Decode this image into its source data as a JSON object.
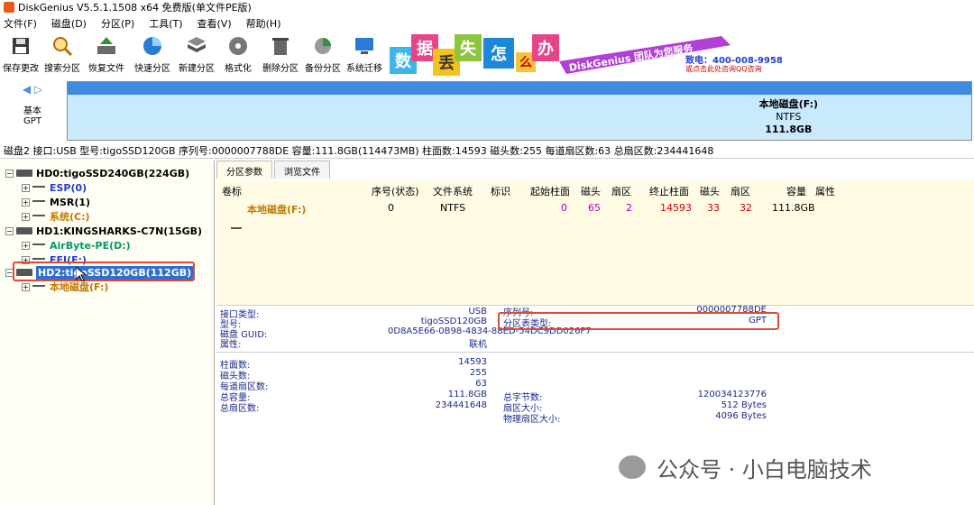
{
  "window": {
    "title": "DiskGenius V5.5.1.1508 x64 免费版(单文件PE版)"
  },
  "menu": [
    "文件(F)",
    "磁盘(D)",
    "分区(P)",
    "工具(T)",
    "查看(V)",
    "帮助(H)"
  ],
  "toolbar": [
    {
      "label": "保存更改",
      "icon": "save-icon"
    },
    {
      "label": "搜索分区",
      "icon": "search-icon"
    },
    {
      "label": "恢复文件",
      "icon": "recover-icon"
    },
    {
      "label": "快速分区",
      "icon": "quick-partition-icon"
    },
    {
      "label": "新建分区",
      "icon": "new-partition-icon"
    },
    {
      "label": "格式化",
      "icon": "format-icon"
    },
    {
      "label": "删除分区",
      "icon": "delete-icon"
    },
    {
      "label": "备份分区",
      "icon": "backup-icon"
    },
    {
      "label": "系统迁移",
      "icon": "migrate-icon"
    }
  ],
  "banner": {
    "tiles": [
      "数",
      "据",
      "丢",
      "失",
      "怎",
      "么",
      "办"
    ],
    "tagline": "DiskGenius 团队为您服务",
    "phone": "400-008-9958",
    "phone_label": "致电：",
    "qq": "或点击此处咨询QQ咨询"
  },
  "disk_nav": {
    "line1": "基本",
    "line2": "GPT"
  },
  "disk_vis": {
    "name": "本地磁盘(F:)",
    "fs": "NTFS",
    "size": "111.8GB"
  },
  "disk_info": "磁盘2 接口:USB  型号:tigoSSD120GB  序列号:0000007788DE  容量:111.8GB(114473MB)  柱面数:14593  磁头数:255  每道扇区数:63  总扇区数:234441648",
  "tree": [
    {
      "label": "HD0:tigoSSD240GB(224GB)",
      "type": "disk",
      "color": "#000000"
    },
    {
      "label": "ESP(0)",
      "type": "part",
      "color": "#1f3fcf"
    },
    {
      "label": "MSR(1)",
      "type": "part",
      "color": "#000000"
    },
    {
      "label": "系统(C:)",
      "type": "part",
      "color": "#c07a00"
    },
    {
      "label": "HD1:KINGSHARKS-C7N(15GB)",
      "type": "disk",
      "color": "#000000"
    },
    {
      "label": "AirByte-PE(D:)",
      "type": "part",
      "color": "#009a6a"
    },
    {
      "label": "EFI(E:)",
      "type": "part",
      "color": "#1f3fcf"
    },
    {
      "label": "HD2:tigoSSD120GB(112GB)",
      "type": "disk",
      "color": "#ffffff"
    },
    {
      "label": "本地磁盘(F:)",
      "type": "part",
      "color": "#c07a00"
    }
  ],
  "tabs": [
    "分区参数",
    "浏览文件"
  ],
  "columns": [
    "卷标",
    "序号(状态)",
    "文件系统",
    "标识",
    "起始柱面",
    "磁头",
    "扇区",
    "终止柱面",
    "磁头",
    "扇区",
    "容量",
    "属性"
  ],
  "row": [
    "本地磁盘(F:)",
    "0",
    "NTFS",
    "",
    "0",
    "65",
    "2",
    "14593",
    "33",
    "32",
    "111.8GB",
    ""
  ],
  "details": {
    "iface_k": "接口类型:",
    "iface_v": "USB",
    "model_k": "型号:",
    "model_v": "tigoSSD120GB",
    "guid_k": "磁盘 GUID:",
    "guid_v": "0D8A5E66-0B98-4834-88ED-54DC9DD026F7",
    "attr_k": "属性:",
    "attr_v": "联机",
    "serial_k": "序列号:",
    "serial_v": "0000007788DE",
    "pt_k": "分区表类型:",
    "pt_v": "GPT",
    "cyl_k": "柱面数:",
    "cyl_v": "14593",
    "heads_k": "磁头数:",
    "heads_v": "255",
    "spt_k": "每道扇区数:",
    "spt_v": "63",
    "cap_k": "总容量:",
    "cap_v": "111.8GB",
    "ts_k": "总扇区数:",
    "ts_v": "234441648",
    "tb_k": "总字节数:",
    "tb_v": "120034123776",
    "ss_k": "扇区大小:",
    "ss_v": "512 Bytes",
    "ps_k": "物理扇区大小:",
    "ps_v": "4096 Bytes"
  },
  "watermark": "公众号 · 小白电脑技术",
  "colors": {
    "accent": "#2f6fd0",
    "highlight_box": "#e04a2e"
  }
}
